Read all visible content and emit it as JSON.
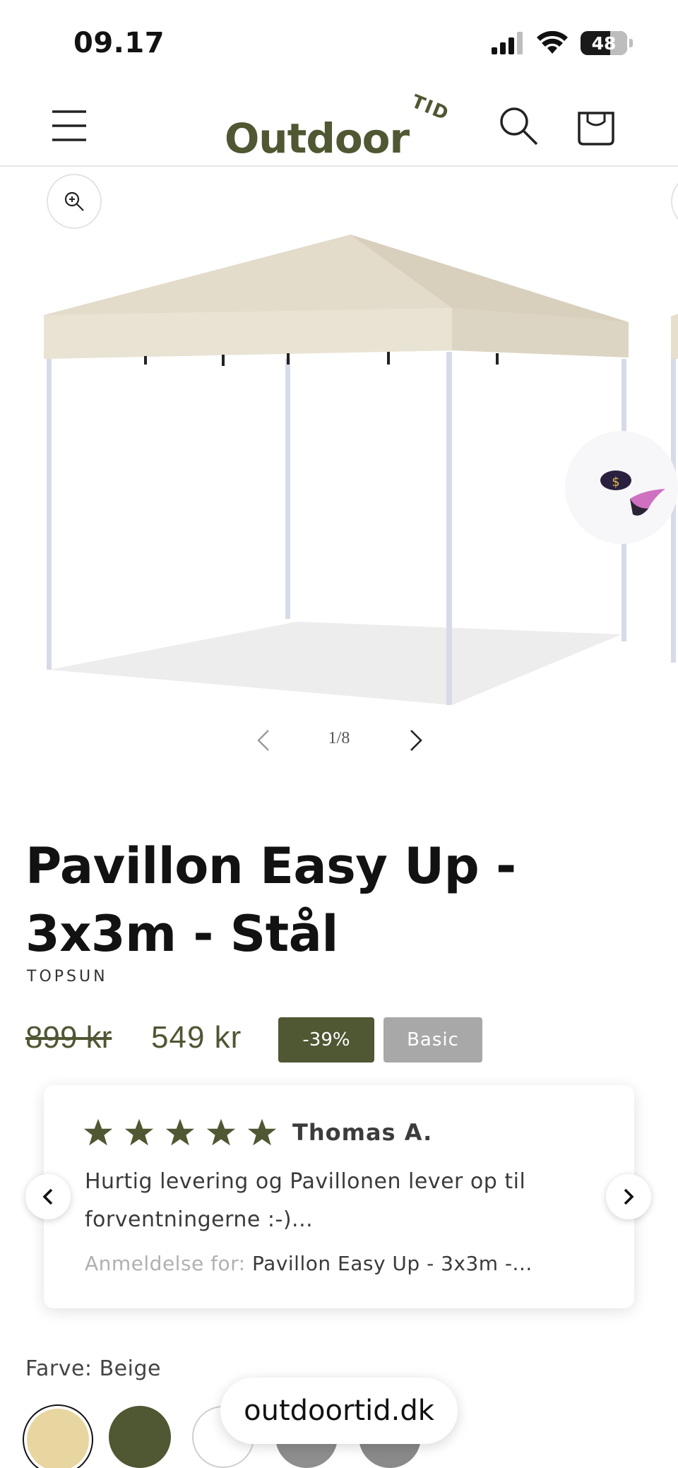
{
  "status_bar": {
    "time": "09.17",
    "battery_level": "48"
  },
  "header": {
    "logo_main": "Outdoor",
    "logo_sup": "TID",
    "icons": [
      "menu-icon",
      "search-icon",
      "cart-icon"
    ]
  },
  "gallery": {
    "counter": "1/8",
    "zoom_icon": "zoom-in-icon",
    "image_fraction": 0.125
  },
  "product": {
    "title": "Pavillon Easy Up - 3x3m - Stål",
    "vendor": "TOPSUN",
    "price_old": "899 kr",
    "price_new": "549 kr",
    "badge_discount": "-39%",
    "badge_tier": "Basic"
  },
  "review": {
    "rating": 5,
    "reviewer": "Thomas A.",
    "text": "Hurtig levering og Pavillonen lever op til forventningerne :-)...",
    "for_label": "Anmeldelse for:",
    "for_product": "Pavillon Easy Up - 3x3m -..."
  },
  "options": {
    "color_label": "Farve: Beige",
    "swatches": [
      {
        "name": "beige",
        "color": "#e8d6a0",
        "selected": true
      },
      {
        "name": "green",
        "color": "#4f5733",
        "selected": false
      },
      {
        "name": "white",
        "color": "#ffffff",
        "selected": false
      },
      {
        "name": "grey",
        "color": "#8e8e8e",
        "selected": false
      },
      {
        "name": "grey-2",
        "color": "#8a8a8a",
        "selected": false
      }
    ]
  },
  "browser": {
    "url": "outdoortid.dk"
  },
  "colors": {
    "brand": "#4f5733",
    "badge_grey": "#a8a8a8",
    "text": "#121212"
  }
}
